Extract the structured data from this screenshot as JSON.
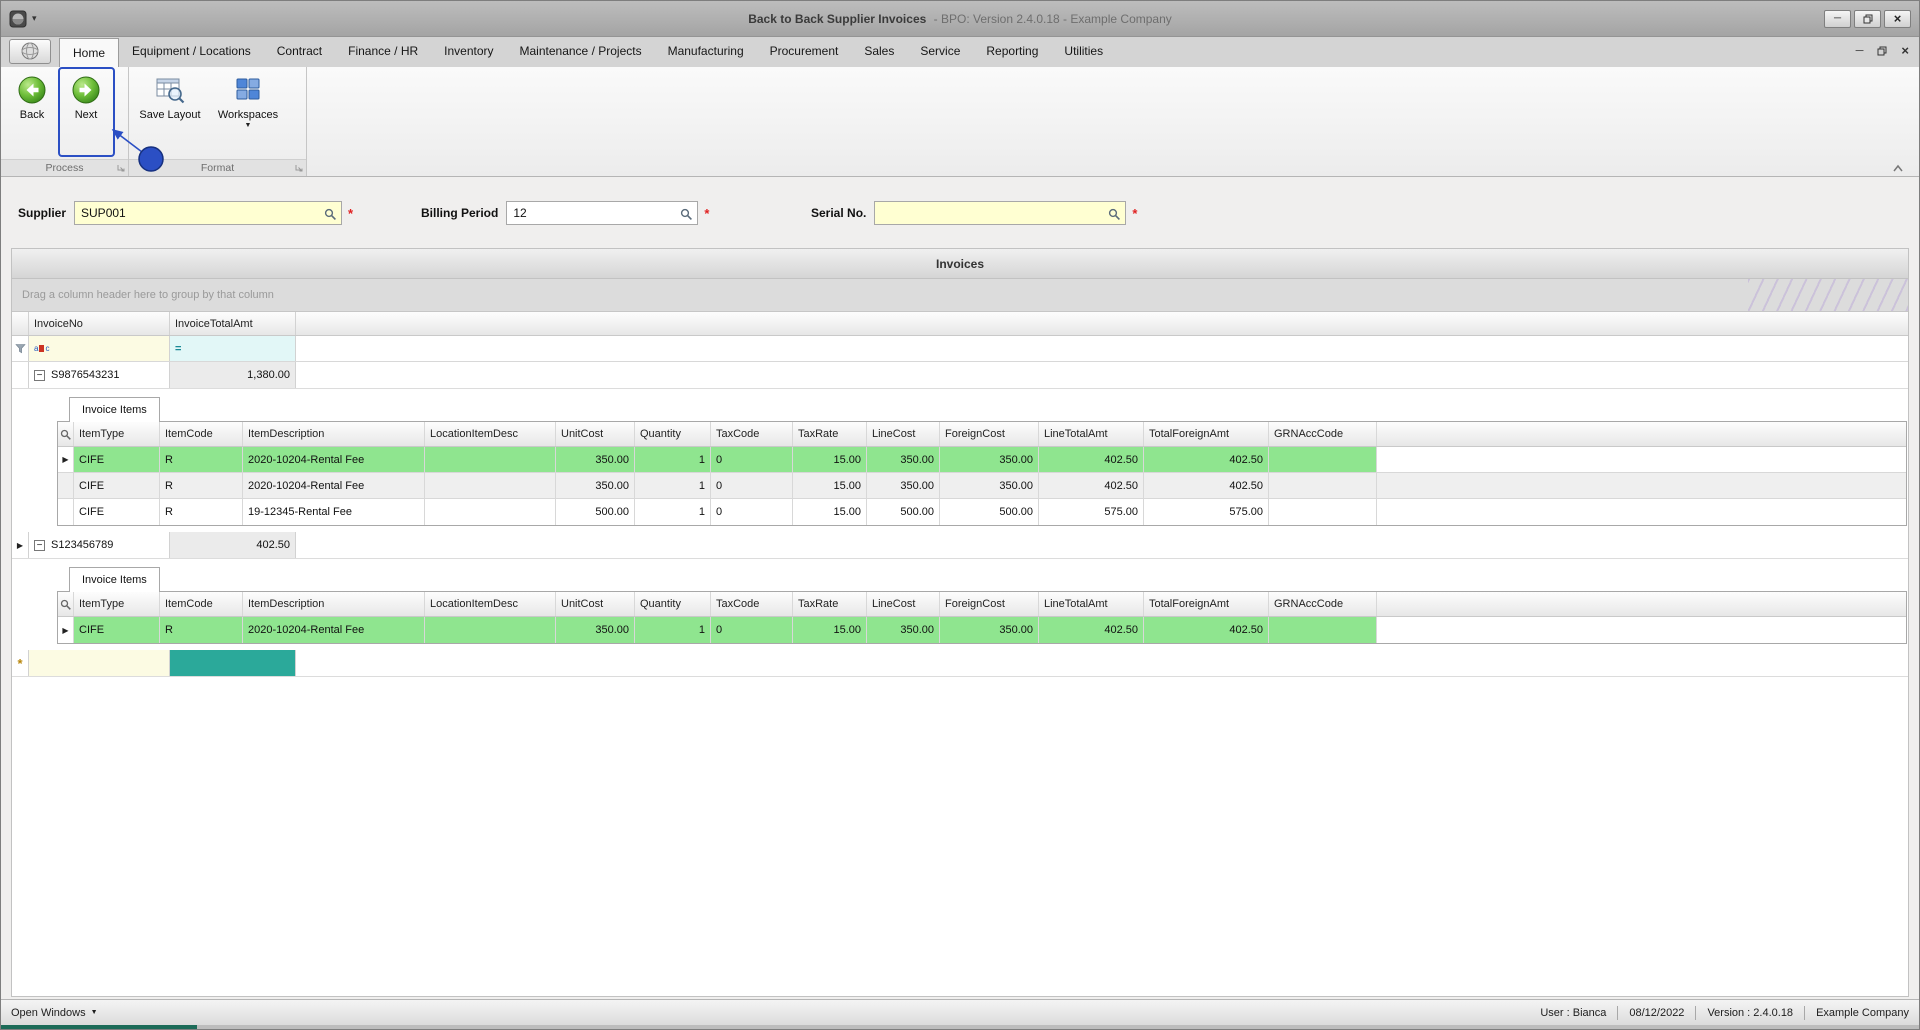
{
  "window": {
    "title": "Back to Back Supplier Invoices",
    "title_suffix": "- BPO: Version 2.4.0.18 - Example Company"
  },
  "ribbon": {
    "tabs": [
      "Home",
      "Equipment / Locations",
      "Contract",
      "Finance / HR",
      "Inventory",
      "Maintenance / Projects",
      "Manufacturing",
      "Procurement",
      "Sales",
      "Service",
      "Reporting",
      "Utilities"
    ],
    "active_tab": "Home",
    "back_label": "Back",
    "next_label": "Next",
    "save_layout_label": "Save Layout",
    "workspaces_label": "Workspaces",
    "group_process": "Process",
    "group_format": "Format"
  },
  "form": {
    "supplier_label": "Supplier",
    "supplier_value": "SUP001",
    "billing_period_label": "Billing Period",
    "billing_period_value": "12",
    "serial_label": "Serial No.",
    "serial_value": "",
    "required_marker": "*"
  },
  "invoices_panel": {
    "title": "Invoices",
    "group_by_hint": "Drag a column header here to group by that column",
    "columns": [
      "InvoiceNo",
      "InvoiceTotalAmt"
    ],
    "filter_equals_icon": "=",
    "detail_columns": [
      "ItemType",
      "ItemCode",
      "ItemDescription",
      "LocationItemDesc",
      "UnitCost",
      "Quantity",
      "TaxCode",
      "TaxRate",
      "LineCost",
      "ForeignCost",
      "LineTotalAmt",
      "TotalForeignAmt",
      "GRNAccCode"
    ],
    "masters": [
      {
        "invoice_no": "S9876543231",
        "invoice_total": "1,380.00",
        "focused": false,
        "detail_tab": "Invoice Items",
        "rows": [
          {
            "selected": true,
            "cells": [
              "CIFE",
              "R",
              "2020-10204-Rental Fee",
              "",
              "350.00",
              "1",
              "0",
              "15.00",
              "350.00",
              "350.00",
              "402.50",
              "402.50",
              ""
            ]
          },
          {
            "selected": false,
            "cells": [
              "CIFE",
              "R",
              "2020-10204-Rental Fee",
              "",
              "350.00",
              "1",
              "0",
              "15.00",
              "350.00",
              "350.00",
              "402.50",
              "402.50",
              ""
            ]
          },
          {
            "selected": false,
            "cells": [
              "CIFE",
              "R",
              "19-12345-Rental Fee",
              "",
              "500.00",
              "1",
              "0",
              "15.00",
              "500.00",
              "500.00",
              "575.00",
              "575.00",
              ""
            ]
          }
        ]
      },
      {
        "invoice_no": "S123456789",
        "invoice_total": "402.50",
        "focused": true,
        "detail_tab": "Invoice Items",
        "rows": [
          {
            "selected": true,
            "cells": [
              "CIFE",
              "R",
              "2020-10204-Rental Fee",
              "",
              "350.00",
              "1",
              "0",
              "15.00",
              "350.00",
              "350.00",
              "402.50",
              "402.50",
              ""
            ]
          }
        ]
      }
    ]
  },
  "status_bar": {
    "open_windows": "Open Windows",
    "user": "User : Bianca",
    "date": "08/12/2022",
    "version": "Version : 2.4.0.18",
    "company": "Example Company"
  },
  "icons": {
    "collapse_row": "−",
    "focused_row": "▶",
    "dropdown_arrow": "▼",
    "new_row": "*",
    "quick_access_dropdown": "▾",
    "minimize": "─",
    "close": "×"
  },
  "colors": {
    "selected_row_green": "#8fe58f",
    "new_cell_teal": "#2ba99a",
    "required_yellow": "#ffffd2",
    "annotation_blue": "#2b4fc4"
  }
}
